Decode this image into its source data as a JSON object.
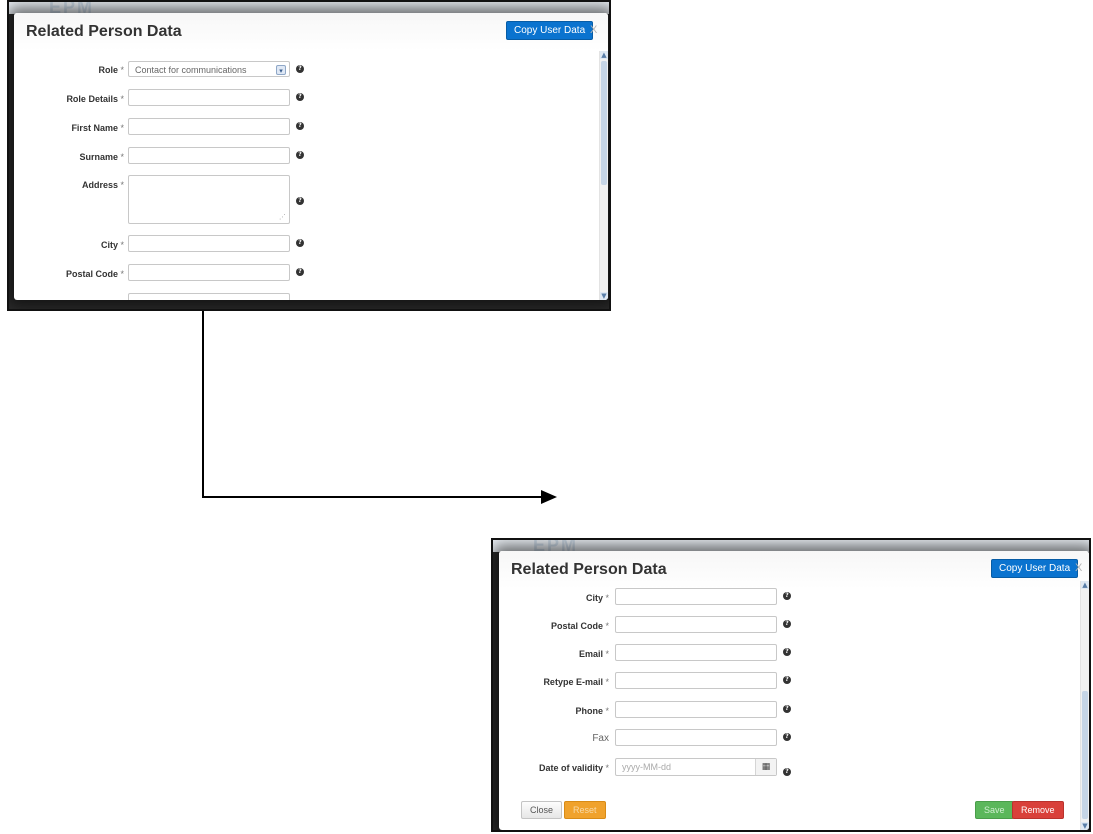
{
  "top_dialog": {
    "title": "Related Person Data",
    "copy_button": "Copy User Data",
    "close": "X",
    "background_logo": "EPM",
    "role": {
      "label": "Role",
      "required": "*",
      "value": "Contact for communications",
      "help": "?"
    },
    "fields": [
      {
        "label": "Role Details",
        "required": "*",
        "help": "?"
      },
      {
        "label": "First Name",
        "required": "*",
        "help": "?"
      },
      {
        "label": "Surname",
        "required": "*",
        "help": "?"
      },
      {
        "label": "Address",
        "required": "*",
        "help": "?"
      },
      {
        "label": "City",
        "required": "*",
        "help": "?"
      },
      {
        "label": "Postal Code",
        "required": "*",
        "help": "?"
      }
    ]
  },
  "bottom_dialog": {
    "title": "Related Person Data",
    "copy_button": "Copy User Data",
    "close": "X",
    "background_logo": "EPM",
    "fields": [
      {
        "label": "City",
        "required": "*",
        "help": "?"
      },
      {
        "label": "Postal Code",
        "required": "*",
        "help": "?"
      },
      {
        "label": "Email",
        "required": "*",
        "help": "?"
      },
      {
        "label": "Retype E-mail",
        "required": "*",
        "help": "?"
      },
      {
        "label": "Phone",
        "required": "*",
        "help": "?"
      },
      {
        "label": "Fax",
        "required": "",
        "help": "?"
      }
    ],
    "date": {
      "label": "Date of validity",
      "required": "*",
      "placeholder": "yyyy-MM-dd",
      "calendar_icon": "calendar-icon",
      "help": "?"
    },
    "footer": {
      "close": "Close",
      "reset": "Reset",
      "save": "Save",
      "remove": "Remove"
    }
  },
  "colors": {
    "primary": "#0a73cf",
    "warning": "#f0a22c",
    "success": "#5bb75b",
    "danger": "#d9403a"
  }
}
